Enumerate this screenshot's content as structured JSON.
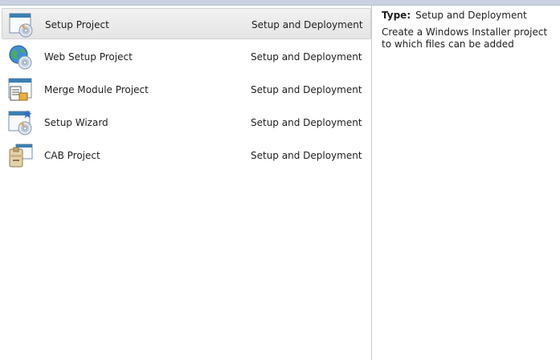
{
  "templates": [
    {
      "name": "Setup Project",
      "category": "Setup and Deployment",
      "icon": "setup-project-icon",
      "selected": true
    },
    {
      "name": "Web Setup Project",
      "category": "Setup and Deployment",
      "icon": "web-setup-project-icon",
      "selected": false
    },
    {
      "name": "Merge Module Project",
      "category": "Setup and Deployment",
      "icon": "merge-module-project-icon",
      "selected": false
    },
    {
      "name": "Setup Wizard",
      "category": "Setup and Deployment",
      "icon": "setup-wizard-icon",
      "selected": false
    },
    {
      "name": "CAB Project",
      "category": "Setup and Deployment",
      "icon": "cab-project-icon",
      "selected": false
    }
  ],
  "details": {
    "type_label": "Type:",
    "type_value": "Setup and Deployment",
    "description": "Create a Windows Installer project to which files can be added"
  },
  "colors": {
    "selection": "#e8e8e8",
    "window_title_blue": "#3c7fb1",
    "topbar": "#c9d2de"
  }
}
